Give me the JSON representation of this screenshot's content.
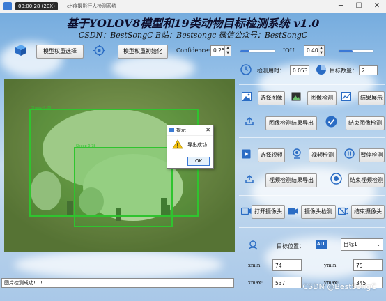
{
  "window": {
    "badge": "00:00:28 (20X)",
    "title": "ch疫摄影行人检测系统",
    "minimize": "─",
    "maximize": "☐",
    "close": "✕"
  },
  "header": {
    "title": "基于YOLOV8模型和19类动物目标检测系统 v1.0",
    "subtitle": "CSDN：BestSongC    B站：Bestsongc    微信公众号：BestSongC"
  },
  "toolbar": {
    "select_weights": "模型权重选择",
    "init_weights": "模型权重初始化",
    "confidence_label": "Confidence:",
    "confidence_value": "0.25",
    "confidence_level": 0.25,
    "iou_label": "IOU:",
    "iou_value": "0.40",
    "iou_level": 0.4
  },
  "image_view": {
    "detections": [
      {
        "label": "Sheep 0.85",
        "color": "#2fc42f"
      },
      {
        "label": "Sheep 0.78",
        "color": "#2fc42f"
      }
    ]
  },
  "stats": {
    "time_label": "检测用时：",
    "time_value": "0.053",
    "count_label": "目标数量：",
    "count_value": "2"
  },
  "image_section": {
    "select_image": "选择图像",
    "detect_image": "图像检测",
    "show_result": "结果展示",
    "export_image": "图像检测结果导出",
    "end_image": "结束图像检测"
  },
  "video_section": {
    "select_video": "选择视频",
    "detect_video": "视频检测",
    "pause_detect": "暂停检测",
    "export_video": "视频检测结果导出",
    "end_video": "结束视频检测"
  },
  "camera_section": {
    "open_camera": "打开摄像头",
    "detect_camera": "摄像头检测",
    "end_camera": "结束摄像头"
  },
  "target": {
    "position_label": "目标位置：",
    "all_icon_text": "ALL",
    "selected_target": "目标1",
    "xmin_label": "xmin:",
    "xmin_value": "74",
    "ymin_label": "ymin:",
    "ymin_value": "75",
    "xmax_label": "xmax:",
    "xmax_value": "537",
    "ymax_label": "ymax:",
    "ymax_value": "345"
  },
  "dialog": {
    "title": "提示",
    "message": "导出成功!",
    "ok": "OK",
    "close": "✕"
  },
  "status": {
    "text": "图片检测成功! ! !"
  },
  "watermark": "CSDN @BestSongC",
  "colors": {
    "accent": "#3a78d6",
    "detection_box": "#2fc42f"
  }
}
